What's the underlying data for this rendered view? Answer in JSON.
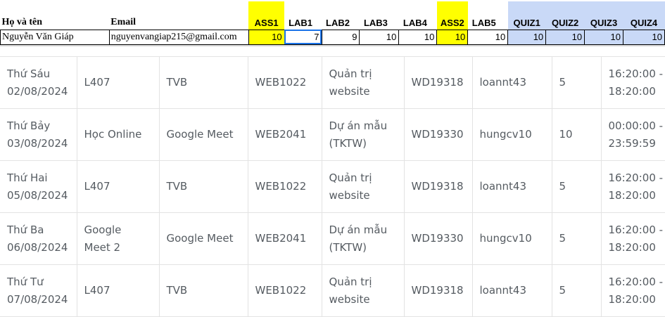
{
  "sheet": {
    "headers": {
      "name": "Họ và tên",
      "email": "Email",
      "ass1": "ASS1",
      "lab1": "LAB1",
      "lab2": "LAB2",
      "lab3": "LAB3",
      "lab4": "LAB4",
      "ass2": "ASS2",
      "lab5": "LAB5",
      "quiz1": "QUIZ1",
      "quiz2": "QUIZ2",
      "quiz3": "QUIZ3",
      "quiz4": "QUIZ4"
    },
    "row": {
      "name": "Nguyễn Văn Giáp",
      "email": "nguyenvangiap215@gmail.com",
      "ass1": "10",
      "lab1": "7",
      "lab2": "9",
      "lab3": "10",
      "lab4": "10",
      "ass2": "10",
      "lab5": "10",
      "quiz1": "10",
      "quiz2": "10",
      "quiz3": "10",
      "quiz4": "10"
    },
    "colors": {
      "yellow": "#ffff00",
      "blue": "#c9d9f7",
      "selection": "#1a73e8"
    }
  },
  "schedule": {
    "rows": [
      {
        "day": "Thứ Sáu",
        "date": "02/08/2024",
        "room1": "L407",
        "room2": "",
        "location": "TVB",
        "course": "WEB1022",
        "subject1": "Quản trị",
        "subject2": "website",
        "class": "WD19318",
        "teacher": "loannt43",
        "slot": "5",
        "time_start": "16:20:00 -",
        "time_end": "18:20:00"
      },
      {
        "day": "Thứ Bảy",
        "date": "03/08/2024",
        "room1": "Học Online",
        "room2": "",
        "location": "Google Meet",
        "course": "WEB2041",
        "subject1": "Dự án mẫu",
        "subject2": "(TKTW)",
        "class": "WD19330",
        "teacher": "hungcv10",
        "slot": "10",
        "time_start": "00:00:00 -",
        "time_end": "23:59:59"
      },
      {
        "day": "Thứ Hai",
        "date": "05/08/2024",
        "room1": "L407",
        "room2": "",
        "location": "TVB",
        "course": "WEB1022",
        "subject1": "Quản trị",
        "subject2": "website",
        "class": "WD19318",
        "teacher": "loannt43",
        "slot": "5",
        "time_start": "16:20:00 -",
        "time_end": "18:20:00"
      },
      {
        "day": "Thứ Ba",
        "date": "06/08/2024",
        "room1": "Google",
        "room2": "Meet 2",
        "location": "Google Meet",
        "course": "WEB2041",
        "subject1": "Dự án mẫu",
        "subject2": "(TKTW)",
        "class": "WD19330",
        "teacher": "hungcv10",
        "slot": "5",
        "time_start": "16:20:00 -",
        "time_end": "18:20:00"
      },
      {
        "day": "Thứ Tư",
        "date": "07/08/2024",
        "room1": "L407",
        "room2": "",
        "location": "TVB",
        "course": "WEB1022",
        "subject1": "Quản trị",
        "subject2": "website",
        "class": "WD19318",
        "teacher": "loannt43",
        "slot": "5",
        "time_start": "16:20:00 -",
        "time_end": "18:20:00"
      }
    ]
  }
}
